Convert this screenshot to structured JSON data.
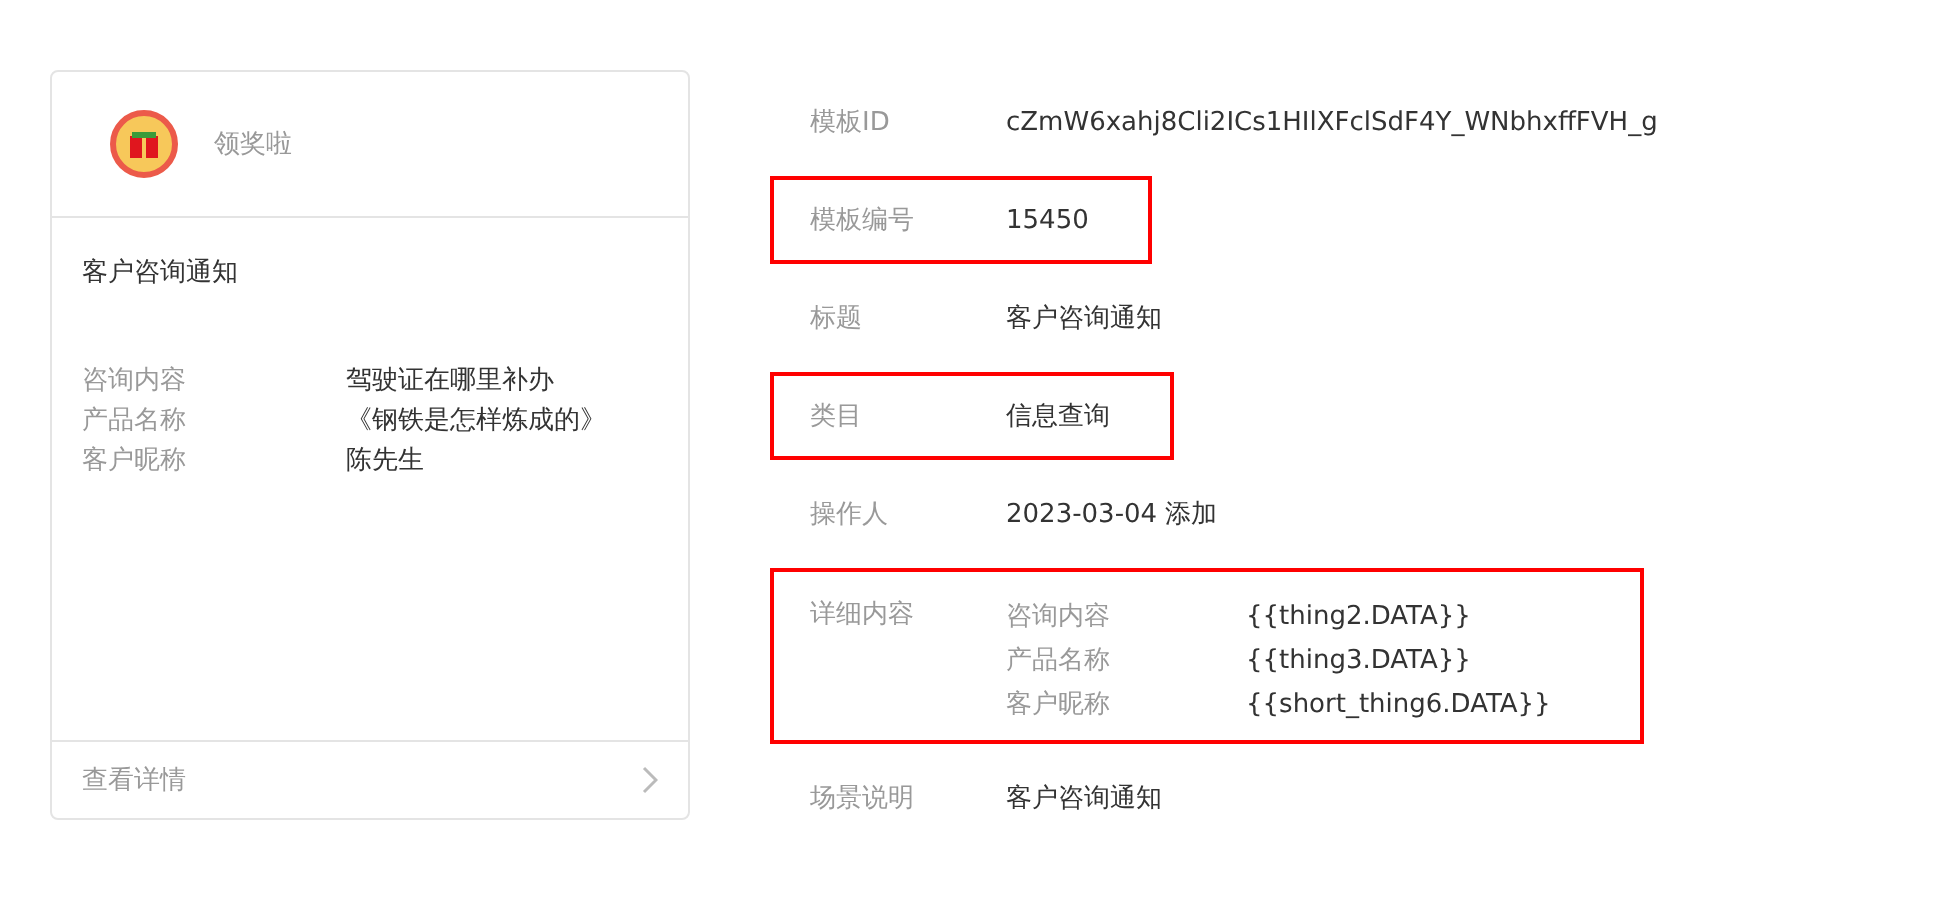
{
  "preview_card": {
    "brand": "领奖啦",
    "title": "客户咨询通知",
    "fields": [
      {
        "label": "咨询内容",
        "value": "驾驶证在哪里补办"
      },
      {
        "label": "产品名称",
        "value": "《钢铁是怎样炼成的》"
      },
      {
        "label": "客户昵称",
        "value": "陈先生"
      }
    ],
    "footer_link": "查看详情"
  },
  "details": [
    {
      "kind": "text",
      "label": "模板ID",
      "value": "cZmW6xahj8Cli2ICs1HIlXFclSdF4Y_WNbhxffFVH_g",
      "highlighted": false
    },
    {
      "kind": "text",
      "label": "模板编号",
      "value": "15450",
      "highlighted": true
    },
    {
      "kind": "text",
      "label": "标题",
      "value": "客户咨询通知",
      "highlighted": false
    },
    {
      "kind": "text",
      "label": "类目",
      "value": "信息查询",
      "highlighted": true
    },
    {
      "kind": "text",
      "label": "操作人",
      "value": "2023-03-04 添加",
      "highlighted": false
    },
    {
      "kind": "fields",
      "label": "详细内容",
      "highlighted": true,
      "fields": [
        {
          "label": "咨询内容",
          "value": "{{thing2.DATA}}"
        },
        {
          "label": "产品名称",
          "value": "{{thing3.DATA}}"
        },
        {
          "label": "客户昵称",
          "value": "{{short_thing6.DATA}}"
        }
      ]
    },
    {
      "kind": "text",
      "label": "场景说明",
      "value": "客户咨询通知",
      "highlighted": false
    }
  ]
}
